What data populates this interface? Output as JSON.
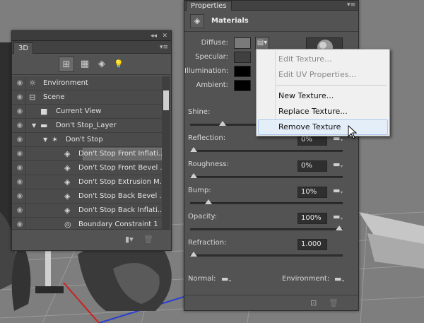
{
  "panel3d": {
    "tab": "3D",
    "collapse_glyph": "◂◂",
    "close_glyph": "✕",
    "menu_glyph": "▾≡",
    "tools": [
      {
        "icon": "scene-filter-icon",
        "glyph": "⊞",
        "active": true
      },
      {
        "icon": "mesh-filter-icon",
        "glyph": "▦",
        "active": false
      },
      {
        "icon": "material-filter-icon",
        "glyph": "◈",
        "active": false
      },
      {
        "icon": "light-filter-icon",
        "glyph": "💡",
        "active": false
      }
    ],
    "rows": [
      {
        "label": "Environment",
        "icon": "environment-icon",
        "glyph": "☼",
        "indent": 0,
        "arrow": ""
      },
      {
        "label": "Scene",
        "icon": "scene-icon",
        "glyph": "⊟",
        "indent": 0,
        "arrow": ""
      },
      {
        "label": "Current View",
        "icon": "camera-icon",
        "glyph": "■",
        "indent": 1,
        "arrow": ""
      },
      {
        "label": "Don't Stop_Layer",
        "icon": "folder-icon",
        "glyph": "▬",
        "indent": 1,
        "arrow": "▼"
      },
      {
        "label": "Don't Stop",
        "icon": "mesh-icon",
        "glyph": "✶",
        "indent": 2,
        "arrow": "▼"
      },
      {
        "label": "Don't Stop Front Inflati...",
        "icon": "material-icon",
        "glyph": "◈",
        "indent": 3,
        "arrow": "",
        "selected": true
      },
      {
        "label": "Don't Stop Front Bevel ...",
        "icon": "material-icon",
        "glyph": "◈",
        "indent": 3,
        "arrow": ""
      },
      {
        "label": "Don't Stop Extrusion M...",
        "icon": "material-icon",
        "glyph": "◈",
        "indent": 3,
        "arrow": ""
      },
      {
        "label": "Don't Stop Back Bevel ...",
        "icon": "material-icon",
        "glyph": "◈",
        "indent": 3,
        "arrow": ""
      },
      {
        "label": "Don't Stop Back Inflati...",
        "icon": "material-icon",
        "glyph": "◈",
        "indent": 3,
        "arrow": ""
      },
      {
        "label": "Boundary Constraint 1",
        "icon": "constraint-icon",
        "glyph": "◎",
        "indent": 3,
        "arrow": ""
      }
    ],
    "footer": {
      "add_glyph": "▾",
      "trash_glyph": "🗑"
    }
  },
  "props": {
    "tab": "Properties",
    "menu_glyph": "▾≡",
    "header": {
      "title": "Materials",
      "icon_glyph": "◈"
    },
    "color_rows": [
      {
        "label": "Diffuse:",
        "swatch_color": "#7a7a7a"
      },
      {
        "label": "Specular:",
        "swatch_color": "#404040"
      },
      {
        "label": "Illumination:",
        "swatch_color": "#000000"
      },
      {
        "label": "Ambient:",
        "swatch_color": "#000000"
      }
    ],
    "shine": {
      "label": "Shine:",
      "value": 0.2
    },
    "reflection": {
      "label": "Reflection:",
      "field": "0%",
      "value": 0
    },
    "roughness": {
      "label": "Roughness:",
      "field": "0%",
      "value": 0
    },
    "bump": {
      "label": "Bump:",
      "field": "10%",
      "value": 0.1
    },
    "opacity": {
      "label": "Opacity:",
      "field": "100%",
      "value": 1
    },
    "refraction": {
      "label": "Refraction:",
      "field": "1.000",
      "value": 0
    },
    "normal_label": "Normal:",
    "environment_label": "Environment:",
    "folder_glyph": "▬",
    "footer": {
      "render_glyph": "⊡",
      "trash_glyph": "🗑"
    }
  },
  "context_menu": {
    "items": [
      {
        "label": "Edit Texture...",
        "enabled": false
      },
      {
        "label": "Edit UV Properties...",
        "enabled": false
      },
      {
        "label": "New Texture...",
        "enabled": true
      },
      {
        "label": "Replace Texture...",
        "enabled": true
      },
      {
        "label": "Remove Texture",
        "enabled": true,
        "hover": true
      }
    ]
  }
}
